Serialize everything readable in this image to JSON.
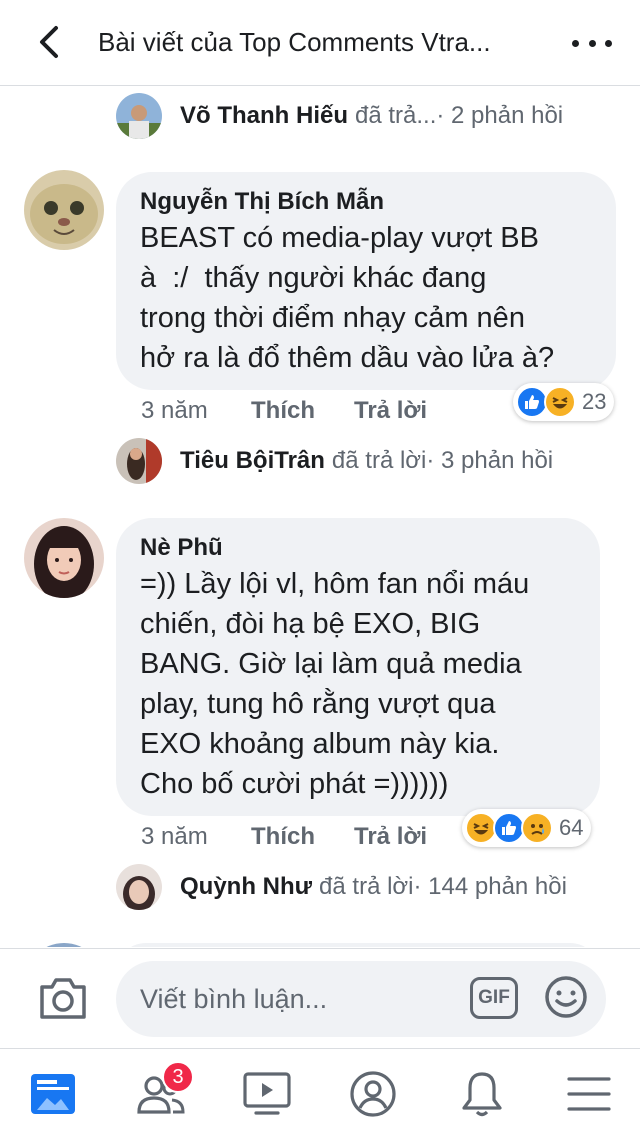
{
  "header": {
    "title": "Bài viết của Top Comments Vtra..."
  },
  "replies": [
    {
      "name": "Võ Thanh Hiếu",
      "rest": "đã trả...",
      "count": " · 2 phản hồi"
    },
    {
      "name": "Tiêu BộiTrân",
      "rest": "đã trả lời",
      "count": " · 3 phản hồi"
    },
    {
      "name": "Quỳnh Như",
      "rest": "đã trả lời",
      "count": " · 144 phản hồi"
    }
  ],
  "comments": [
    {
      "author": "Nguyễn Thị Bích Mẫn",
      "text": "BEAST có media-play vượt BB\nà  :/  thấy người khác đang\ntrong thời điểm nhạy cảm nên\nhở ra là đổ thêm dầu vào lửa à?",
      "time": "3 năm",
      "like": "Thích",
      "reply": "Trả lời",
      "reaction_count": "23",
      "reactions": [
        "like-icon",
        "haha-icon"
      ]
    },
    {
      "author": "Nè Phũ",
      "text": "=)) Lầy lội vl, hôm fan nổi máu\nchiến, đòi hạ bệ EXO, BIG\nBANG. Giờ lại làm quả media\nplay, tung hô rằng vượt qua\nEXO khoảng album này kia.\nCho bố cười phát =))))))",
      "time": "3 năm",
      "like": "Thích",
      "reply": "Trả lời",
      "reaction_count": "64",
      "reactions": [
        "haha-icon",
        "like-icon",
        "sad-icon"
      ]
    }
  ],
  "composer": {
    "placeholder": "Viết bình luận...",
    "gif_label": "GIF"
  },
  "nav": {
    "friends_badge": "3"
  },
  "colors": {
    "accent": "#1877f2",
    "bubble": "#f0f2f5",
    "muted": "#606770",
    "badge": "#f02849"
  }
}
